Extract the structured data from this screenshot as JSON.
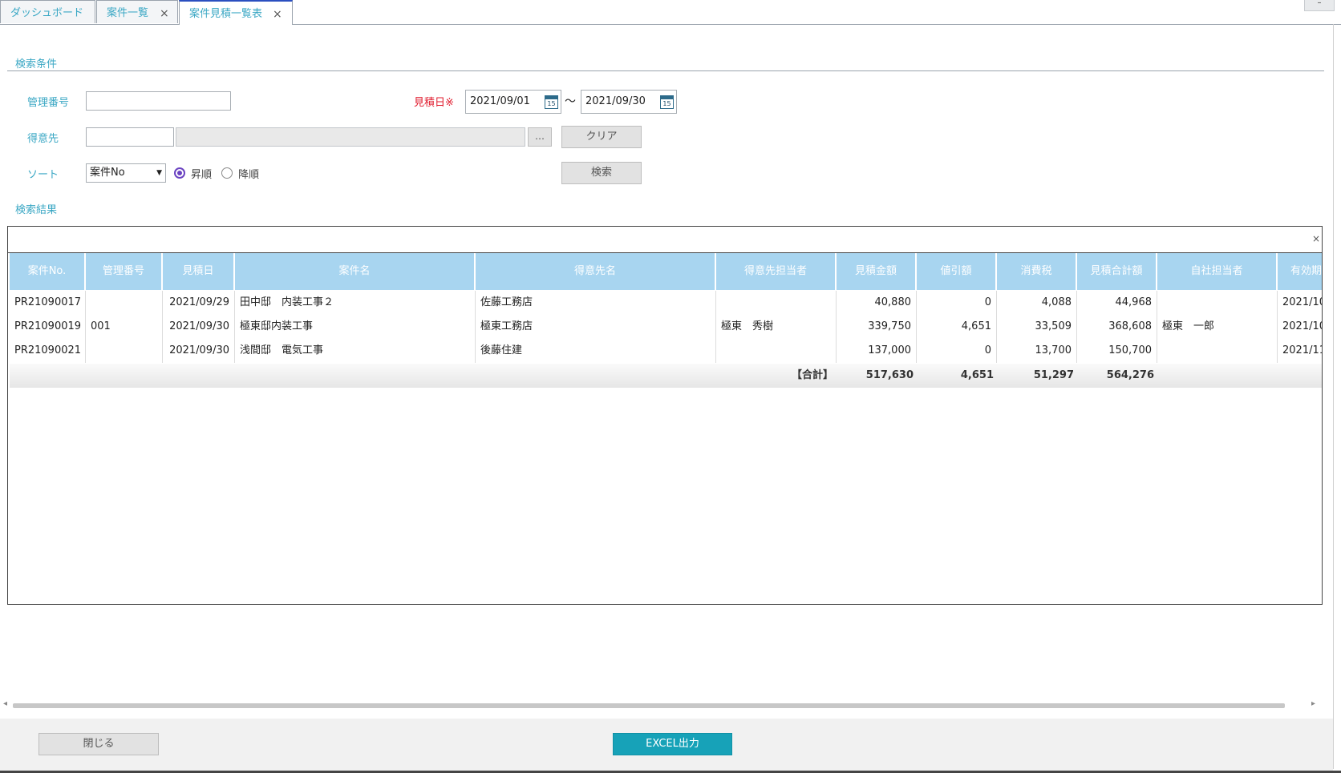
{
  "tabs": [
    {
      "label": "ダッシュボード",
      "closable": false
    },
    {
      "label": "案件一覧",
      "closable": true
    },
    {
      "label": "案件見積一覧表",
      "closable": true,
      "active": true
    }
  ],
  "tab_close_glyph": "×",
  "window_minimize": "–",
  "search": {
    "section_title": "検索条件",
    "kanri_label": "管理番号",
    "kanri_value": "",
    "mitsumori_label": "見積日",
    "required_mark": "※",
    "date_from": "2021/09/01",
    "date_to": "2021/09/30",
    "date_sep": "～",
    "calendar_day": "15",
    "tokuisaki_label": "得意先",
    "tokuisaki_code": "",
    "tokuisaki_name": "",
    "lookup_label": "…",
    "clear_label": "クリア",
    "sort_label": "ソート",
    "sort_value": "案件No",
    "sort_asc": "昇順",
    "sort_desc": "降順",
    "sort_selected": "asc",
    "search_button": "検索"
  },
  "results": {
    "section_title": "検索結果",
    "columns": [
      "案件No.",
      "管理番号",
      "見積日",
      "案件名",
      "得意先名",
      "得意先担当者",
      "見積金額",
      "値引額",
      "消費税",
      "見積合計額",
      "自社担当者",
      "有効期"
    ],
    "rows": [
      [
        "PR21090017",
        "",
        "2021/09/29",
        "田中邸　内装工事２",
        "佐藤工務店",
        "",
        "40,880",
        "0",
        "4,088",
        "44,968",
        "",
        "2021/10"
      ],
      [
        "PR21090019",
        "001",
        "2021/09/30",
        "極東邸内装工事",
        "極東工務店",
        "極東　秀樹",
        "339,750",
        "4,651",
        "33,509",
        "368,608",
        "極東　一郎",
        "2021/10"
      ],
      [
        "PR21090021",
        "",
        "2021/09/30",
        "浅間邸　電気工事",
        "後藤住建",
        "",
        "137,000",
        "0",
        "13,700",
        "150,700",
        "",
        "2021/11"
      ]
    ],
    "totals": {
      "label": "【合計】",
      "mitsumori": "517,630",
      "nebiki": "4,651",
      "shohizei": "51,297",
      "gokei": "564,276"
    }
  },
  "footer": {
    "close_label": "閉じる",
    "excel_label": "EXCEL出力"
  },
  "colors": {
    "accent_text": "#3aa7c4",
    "header_bg": "#a8d5f0",
    "primary_button": "#17a2b8",
    "required": "#e0192b",
    "radio": "#6a42c1"
  }
}
